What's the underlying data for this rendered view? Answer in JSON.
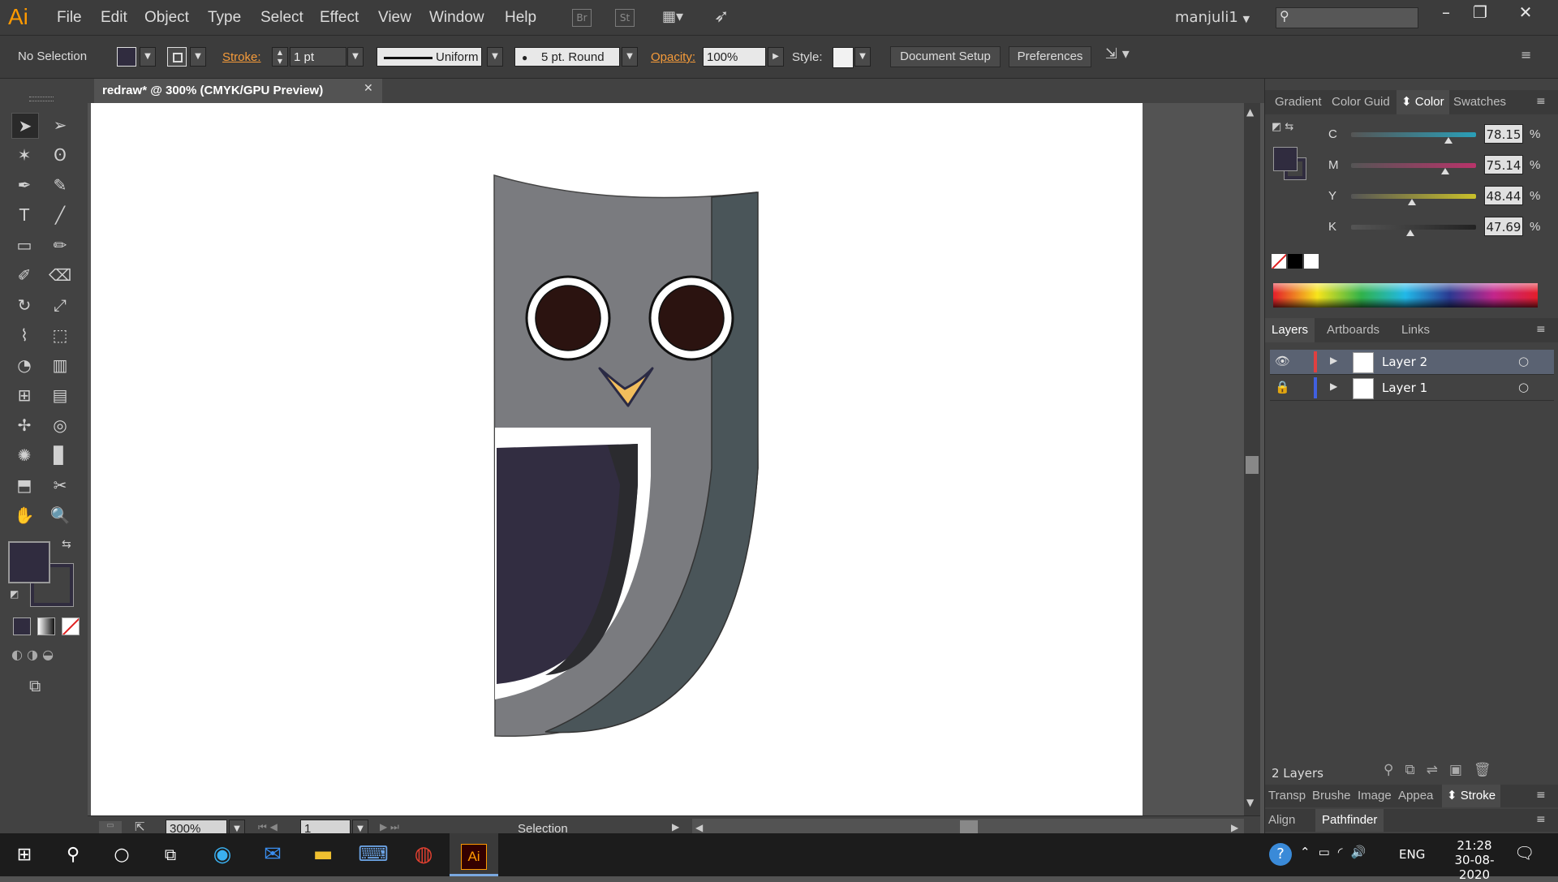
{
  "app": {
    "logo": "Ai"
  },
  "menu": [
    "File",
    "Edit",
    "Object",
    "Type",
    "Select",
    "Effect",
    "View",
    "Window",
    "Help"
  ],
  "top_icons": {
    "bridge": "Br",
    "stock": "St"
  },
  "user": "manjuli1",
  "control": {
    "selection": "No Selection",
    "stroke_label": "Stroke:",
    "stroke_weight": "1 pt",
    "profile": "Uniform",
    "brush": "5 pt. Round",
    "opacity_label": "Opacity:",
    "opacity": "100%",
    "style_label": "Style:",
    "doc_setup": "Document Setup",
    "preferences": "Preferences"
  },
  "document": {
    "tab_title": "redraw* @ 300% (CMYK/GPU Preview)"
  },
  "status": {
    "zoom": "300%",
    "artboard": "1",
    "tool": "Selection"
  },
  "color_panel": {
    "tabs": [
      "Gradient",
      "Color Guid",
      "Color",
      "Swatches"
    ],
    "channels": [
      {
        "name": "C",
        "value": "78.15",
        "unit": "%",
        "fraction": 0.7815,
        "color": "#2a9fb8"
      },
      {
        "name": "M",
        "value": "75.14",
        "unit": "%",
        "fraction": 0.7514,
        "color": "#b8336a"
      },
      {
        "name": "Y",
        "value": "48.44",
        "unit": "%",
        "fraction": 0.4844,
        "color": "#c9c02a"
      },
      {
        "name": "K",
        "value": "47.69",
        "unit": "%",
        "fraction": 0.4769,
        "color": "#222222"
      }
    ],
    "fill_color": "#302c3f"
  },
  "layers_panel": {
    "tabs": [
      "Layers",
      "Artboards",
      "Links"
    ],
    "layers": [
      {
        "name": "Layer 2",
        "color": "#e04040",
        "selected": true
      },
      {
        "name": "Layer 1",
        "color": "#4060e0",
        "selected": false
      }
    ],
    "count": "2 Layers"
  },
  "bottom_panels": {
    "row1": [
      "Transp",
      "Brushe",
      "Image",
      "Appea",
      "Stroke"
    ],
    "row2": [
      "Align",
      "Pathfinder"
    ]
  },
  "taskbar": {
    "time": "21:28",
    "date": "30-08-2020",
    "lang": "ENG"
  },
  "icons": [
    "selection-tool",
    "direct-selection-tool",
    "magic-wand",
    "lasso",
    "pen",
    "curvature",
    "type",
    "line",
    "rectangle",
    "paintbrush",
    "pencil",
    "eraser",
    "rotate",
    "scale",
    "warp",
    "free-transform",
    "shape-builder",
    "perspective-grid",
    "mesh",
    "gradient",
    "eyedropper",
    "blend",
    "symbol-sprayer",
    "column-graph",
    "artboard",
    "slice",
    "hand",
    "zoom"
  ],
  "owl_colors": {
    "body": "#7a7b7f",
    "side": "#4a5559",
    "wing": "#322d41",
    "wing_shadow": "#2b2b2f",
    "eye": "#2b1310",
    "beak": "#f2be5c"
  }
}
